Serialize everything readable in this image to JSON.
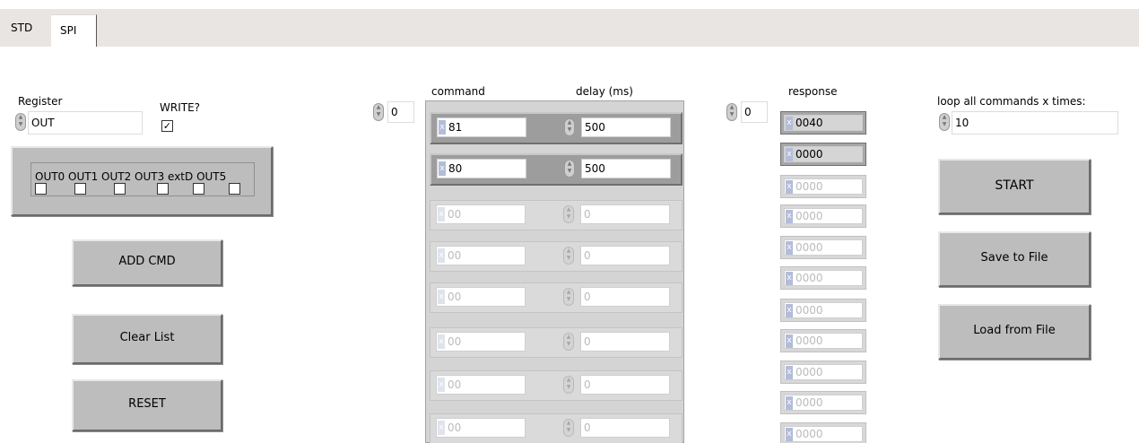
{
  "tabs": [
    {
      "label": "STD",
      "active": false
    },
    {
      "label": "SPI",
      "active": true
    }
  ],
  "register": {
    "label": "Register",
    "value": "OUT"
  },
  "write": {
    "label": "WRITE?",
    "checked": true
  },
  "outputs": {
    "labels": [
      "OUT0",
      "OUT1",
      "OUT2",
      "OUT3",
      "extD",
      "OUT5"
    ],
    "label_line": "OUT0 OUT1 OUT2 OUT3 extD OUT5"
  },
  "buttons": {
    "add_cmd": "ADD CMD",
    "clear_list": "Clear List",
    "reset": "RESET",
    "start": "START",
    "save": "Save to File",
    "load": "Load from File"
  },
  "command_array": {
    "index": "0",
    "command_header": "command",
    "delay_header": "delay (ms)",
    "rows": [
      {
        "command": "81",
        "delay": "500",
        "active": true
      },
      {
        "command": "80",
        "delay": "500",
        "active": true
      },
      {
        "command": "00",
        "delay": "0",
        "active": false
      },
      {
        "command": "00",
        "delay": "0",
        "active": false
      },
      {
        "command": "00",
        "delay": "0",
        "active": false
      },
      {
        "command": "00",
        "delay": "0",
        "active": false
      },
      {
        "command": "00",
        "delay": "0",
        "active": false
      },
      {
        "command": "00",
        "delay": "0",
        "active": false
      }
    ]
  },
  "response_array": {
    "index": "0",
    "header": "response",
    "values": [
      "0040",
      "0000",
      "0000",
      "0000",
      "0000",
      "0000",
      "0000",
      "0000",
      "0000",
      "0000",
      "0000"
    ],
    "active_count": 2
  },
  "loop": {
    "label": "loop all commands x times:",
    "value": "10"
  },
  "icons": {
    "spin": "spinner-icon",
    "hex": "hex-radix-icon",
    "check": "checkmark-icon"
  }
}
